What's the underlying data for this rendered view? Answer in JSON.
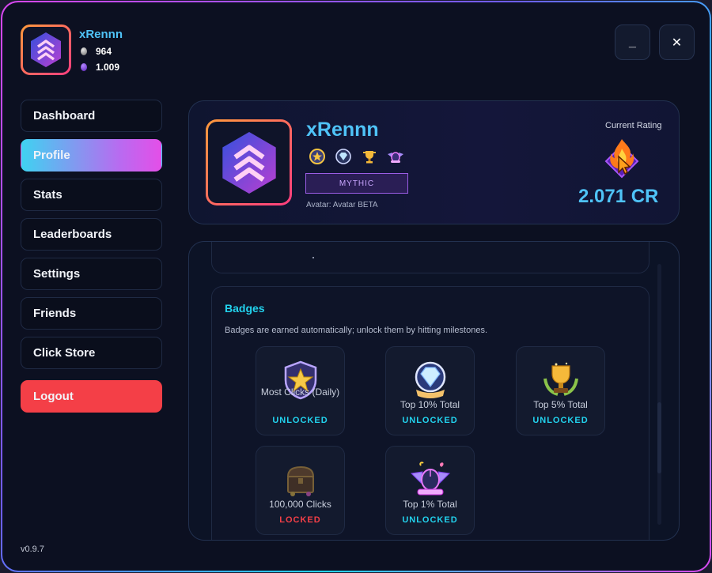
{
  "header": {
    "username": "xRennn",
    "currency_silver": "964",
    "currency_purple": "1.009",
    "minimize_label": "_",
    "close_label": "✕"
  },
  "sidebar": {
    "items": [
      {
        "label": "Dashboard"
      },
      {
        "label": "Profile",
        "active": true
      },
      {
        "label": "Stats"
      },
      {
        "label": "Leaderboards"
      },
      {
        "label": "Settings"
      },
      {
        "label": "Friends"
      },
      {
        "label": "Click Store"
      }
    ],
    "logout_label": "Logout",
    "version": "v0.9.7"
  },
  "profile": {
    "name": "xRennn",
    "rank": "MYTHIC",
    "avatar_caption": "Avatar: Avatar BETA",
    "rating_label": "Current Rating",
    "rating_value": "2.071 CR",
    "mini_badges": [
      "star-shield-icon",
      "diamond-icon",
      "trophy-icon",
      "winged-mouse-icon"
    ]
  },
  "badges": {
    "title": "Badges",
    "description": "Badges are earned automatically; unlock them by hitting milestones.",
    "items": [
      {
        "name": "Most Clicks (Daily)",
        "status": "UNLOCKED",
        "icon": "star-shield-icon"
      },
      {
        "name": "Top 10% Total",
        "status": "UNLOCKED",
        "icon": "diamond-icon"
      },
      {
        "name": "Top 5% Total",
        "status": "UNLOCKED",
        "icon": "trophy-icon"
      },
      {
        "name": "100,000 Clicks",
        "status": "LOCKED",
        "icon": "treasure-chest-icon"
      },
      {
        "name": "Top 1% Total",
        "status": "UNLOCKED",
        "icon": "winged-mouse-icon"
      }
    ]
  },
  "colors": {
    "accent_cyan": "#22d3ee",
    "accent_magenta": "#e44fe8",
    "logout_red": "#f43f47",
    "locked_red": "#f43f47",
    "background": "#0c1021"
  }
}
